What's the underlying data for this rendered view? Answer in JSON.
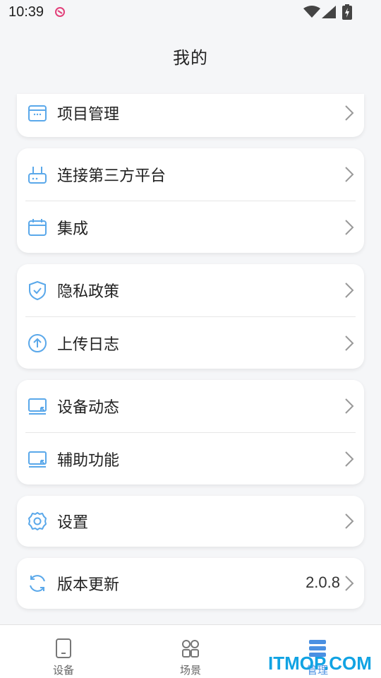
{
  "status_bar": {
    "time": "10:39"
  },
  "header": {
    "title": "我的"
  },
  "menu": {
    "project_management": "项目管理",
    "connect_third_party": "连接第三方平台",
    "integration": "集成",
    "privacy_policy": "隐私政策",
    "upload_log": "上传日志",
    "device_status": "设备动态",
    "accessibility": "辅助功能",
    "settings": "设置",
    "version_update": "版本更新",
    "version_value": "2.0.8"
  },
  "bottom_nav": {
    "items": [
      {
        "label": "设备",
        "icon": "phone-device-icon"
      },
      {
        "label": "场景",
        "icon": "grid-scenes-icon"
      },
      {
        "label": "管理",
        "icon": "list-manage-icon"
      }
    ],
    "active_index": 2
  },
  "watermark": "ITMOP.COM",
  "colors": {
    "accent": "#4a90e2",
    "icon_blue": "#5aa8ea",
    "watermark": "#11a3e3"
  }
}
